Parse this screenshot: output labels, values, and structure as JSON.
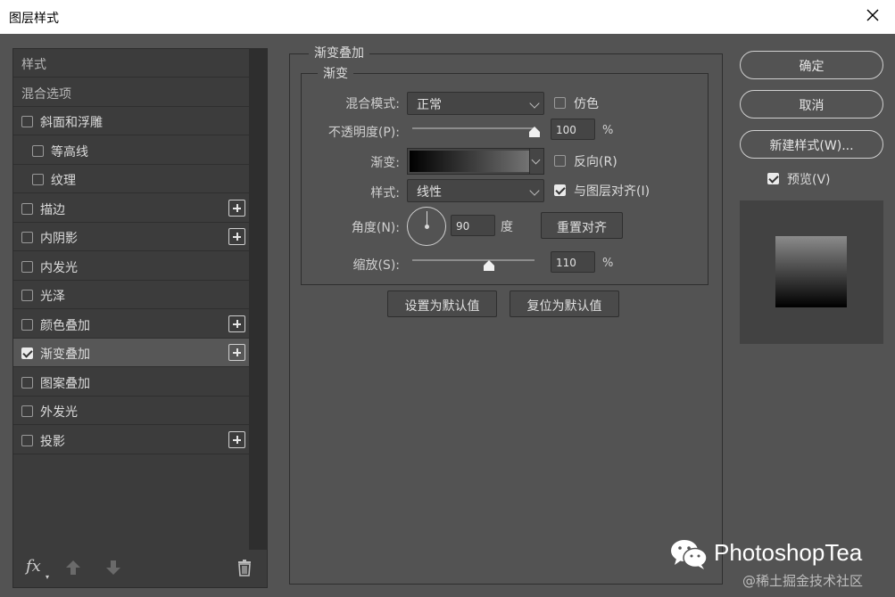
{
  "window": {
    "title": "图层样式"
  },
  "style_list": {
    "items": [
      {
        "label": "样式",
        "type": "header"
      },
      {
        "label": "混合选项",
        "type": "header"
      },
      {
        "label": "斜面和浮雕",
        "checked": false,
        "indent": 0,
        "plus": false
      },
      {
        "label": "等高线",
        "checked": false,
        "indent": 1,
        "plus": false
      },
      {
        "label": "纹理",
        "checked": false,
        "indent": 1,
        "plus": false
      },
      {
        "label": "描边",
        "checked": false,
        "indent": 0,
        "plus": true
      },
      {
        "label": "内阴影",
        "checked": false,
        "indent": 0,
        "plus": true
      },
      {
        "label": "内发光",
        "checked": false,
        "indent": 0,
        "plus": false
      },
      {
        "label": "光泽",
        "checked": false,
        "indent": 0,
        "plus": false
      },
      {
        "label": "颜色叠加",
        "checked": false,
        "indent": 0,
        "plus": true
      },
      {
        "label": "渐变叠加",
        "checked": true,
        "indent": 0,
        "plus": true,
        "active": true
      },
      {
        "label": "图案叠加",
        "checked": false,
        "indent": 0,
        "plus": false
      },
      {
        "label": "外发光",
        "checked": false,
        "indent": 0,
        "plus": false
      },
      {
        "label": "投影",
        "checked": false,
        "indent": 0,
        "plus": true
      }
    ],
    "fx_label": "fx"
  },
  "gradient_overlay": {
    "section_title": "渐变叠加",
    "group_title": "渐变",
    "blend_mode": {
      "label": "混合模式:",
      "value": "正常"
    },
    "dither": {
      "label": "仿色",
      "checked": false
    },
    "opacity": {
      "label": "不透明度(P):",
      "value": "100",
      "unit": "%",
      "level": 1.0
    },
    "gradient": {
      "label": "渐变:",
      "from_color": "#000000",
      "to_color": "#737373"
    },
    "reverse": {
      "label": "反向(R)",
      "checked": false
    },
    "style": {
      "label": "样式:",
      "value": "线性"
    },
    "align_with_layer": {
      "label": "与图层对齐(I)",
      "checked": true
    },
    "angle": {
      "label": "角度(N):",
      "value": "90",
      "unit": "度"
    },
    "reset_alignment": "重置对齐",
    "scale": {
      "label": "缩放(S):",
      "value": "110",
      "unit": "%",
      "level": 0.63
    },
    "make_default": "设置为默认值",
    "reset_default": "复位为默认值"
  },
  "actions": {
    "ok": "确定",
    "cancel": "取消",
    "new_style": "新建样式(W)...",
    "preview": {
      "label": "预览(V)",
      "checked": true
    }
  },
  "watermark": {
    "brand": "PhotoshopTea",
    "sub": "@稀土掘金技术社区"
  }
}
